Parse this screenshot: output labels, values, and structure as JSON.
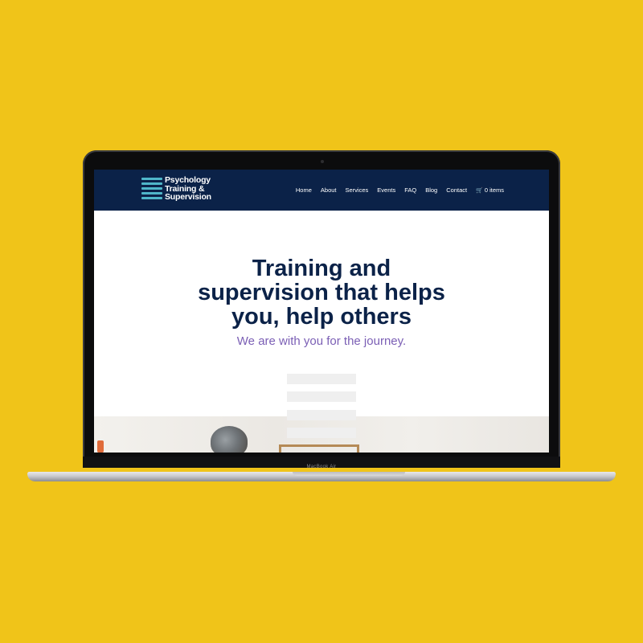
{
  "laptop": {
    "model_label": "MacBook Air"
  },
  "site": {
    "logo": {
      "line1": "Psychology",
      "line2": "Training &",
      "line3": "Supervision"
    },
    "nav": [
      {
        "label": "Home"
      },
      {
        "label": "About"
      },
      {
        "label": "Services"
      },
      {
        "label": "Events"
      },
      {
        "label": "FAQ"
      },
      {
        "label": "Blog"
      },
      {
        "label": "Contact"
      },
      {
        "label": "0 items",
        "icon": "cart-icon"
      }
    ]
  },
  "hero": {
    "title_line1": "Training and",
    "title_line2": "supervision that helps",
    "title_line3": "you, help others",
    "subtitle": "We are with you for the journey."
  },
  "colors": {
    "background": "#f0c419",
    "header": "#0b2248",
    "logo_accent": "#4fb6c9",
    "subtitle": "#7b5fb5"
  }
}
